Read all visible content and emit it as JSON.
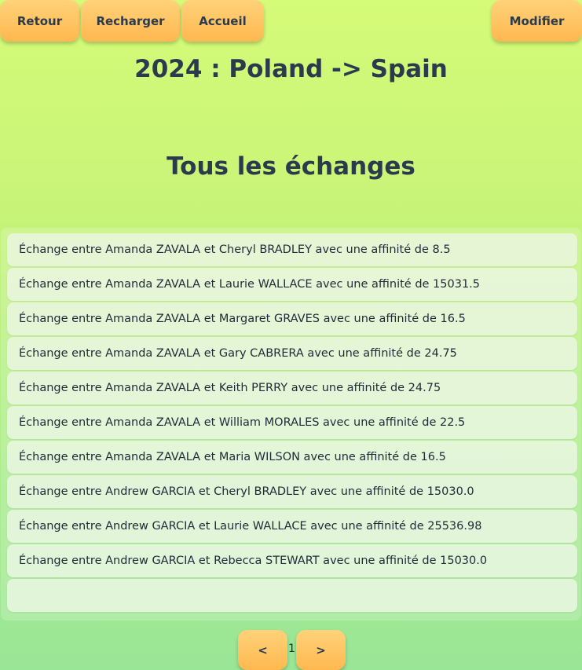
{
  "toolbar": {
    "back_label": "Retour",
    "reload_label": "Recharger",
    "home_label": "Accueil",
    "edit_label": "Modifier"
  },
  "header": {
    "title": "2024 : Poland -> Spain",
    "section_title": "Tous les échanges"
  },
  "exchanges": [
    "Échange entre Amanda ZAVALA et Cheryl BRADLEY avec une affinité de 8.5",
    "Échange entre Amanda ZAVALA et Laurie WALLACE avec une affinité de 15031.5",
    "Échange entre Amanda ZAVALA et Margaret GRAVES avec une affinité de 16.5",
    "Échange entre Amanda ZAVALA et Gary CABRERA avec une affinité de 24.75",
    "Échange entre Amanda ZAVALA et Keith PERRY avec une affinité de 24.75",
    "Échange entre Amanda ZAVALA et William MORALES avec une affinité de 22.5",
    "Échange entre Amanda ZAVALA et Maria WILSON avec une affinité de 16.5",
    "Échange entre Andrew GARCIA et Cheryl BRADLEY avec une affinité de 15030.0",
    "Échange entre Andrew GARCIA et Laurie WALLACE avec une affinité de 25536.98",
    "Échange entre Andrew GARCIA et Rebecca STEWART avec une affinité de 15030.0",
    ""
  ],
  "pagination": {
    "prev_label": "<",
    "current_page": "1",
    "next_label": ">"
  }
}
